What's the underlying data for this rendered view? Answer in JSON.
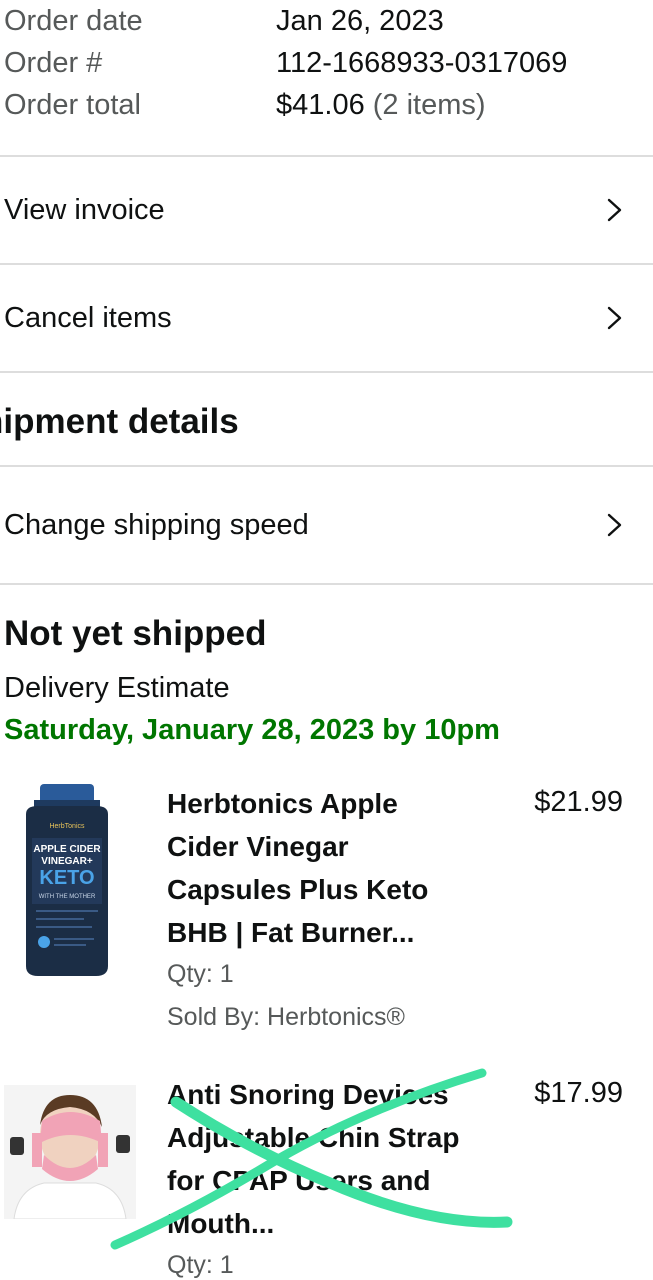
{
  "order": {
    "date_label": "Order date",
    "date_value": "Jan 26, 2023",
    "number_label": "Order #",
    "number_value": "112-1668933-0317069",
    "total_label": "Order total",
    "total_value": "$41.06",
    "total_items": "(2 items)"
  },
  "actions": {
    "view_invoice": "View invoice",
    "cancel_items": "Cancel items"
  },
  "shipment": {
    "section_title": "hipment details",
    "change_speed": "Change shipping speed",
    "status": "Not yet shipped",
    "delivery_label": "Delivery Estimate",
    "delivery_date": "Saturday, January 28, 2023 by 10pm"
  },
  "items": [
    {
      "title": "Herbtonics Apple Cider Vinegar Capsules Plus Keto BHB | Fat Burner...",
      "price": "$21.99",
      "qty": "Qty: 1",
      "seller": "Sold By: Herbtonics®",
      "image_text": {
        "brand": "HerbTonics",
        "line1": "APPLE CIDER",
        "line2": "VINEGAR+",
        "line3": "KETO",
        "line4": "WITH THE MOTHER"
      }
    },
    {
      "title": "Anti Snoring Devices Adjustable Chin Strap for CPAP Users and Mouth...",
      "price": "$17.99",
      "qty": "Qty: 1"
    }
  ],
  "colors": {
    "delivery_green": "#007600",
    "muted_text": "#565959",
    "divider": "#dddddd",
    "scribble": "#3ee0a0"
  },
  "icons": {
    "nav_arrow": "chevron-right-icon"
  }
}
